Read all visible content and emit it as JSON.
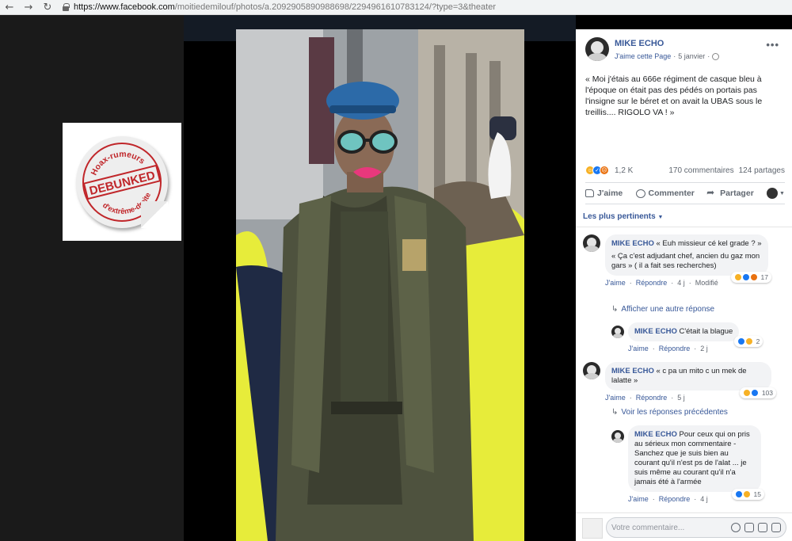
{
  "browser": {
    "url_host": "https://www.facebook.com",
    "url_path": "/moitiedemilouf/photos/a.2092905890988698/2294961610783124/?type=3&theater",
    "back_icon": "←",
    "forward_icon": "→",
    "reload_icon": "↻"
  },
  "badge": {
    "top_text": "Hoax-rumeurs",
    "center_text": "DEBUNKED",
    "bottom_text": "d'extrême-droite"
  },
  "post": {
    "author": "MIKE ECHO",
    "like_page": "J'aime cette Page",
    "date": "5 janvier",
    "more": "•••",
    "text": "« Moi j'étais au 666e régiment de casque bleu à l'époque on était pas des pédés on portais pas l'insigne sur le béret et on avait la UBAS sous le treillis.... RIGOLO VA ! »",
    "reactions_count": "1,2 K",
    "comments_count": "170 commentaires",
    "shares_count": "124 partages"
  },
  "actions": {
    "like": "J'aime",
    "comment": "Commenter",
    "share": "Partager"
  },
  "filter": "Les plus pertinents",
  "comments": [
    {
      "author": "MIKE ECHO",
      "text1": "« Euh missieur cé kel grade ? »",
      "text2": "« Ça c'est adjudant chef, ancien du gaz mon gars » ( il a fait ses recherches)",
      "like": "J'aime",
      "reply": "Répondre",
      "time": "4 j",
      "modified": "Modifié",
      "count": "17"
    },
    {
      "author": "MIKE ECHO",
      "text": "« c pa un mito c un mek de lalatte »",
      "like": "J'aime",
      "reply": "Répondre",
      "time": "5 j",
      "count": "103"
    }
  ],
  "reply_links": {
    "another": "Afficher une autre réponse",
    "previous": "Voir les réponses précédentes"
  },
  "replies": [
    {
      "author": "MIKE ECHO",
      "text": "C'était la blague",
      "like": "J'aime",
      "reply": "Répondre",
      "time": "2 j",
      "count": "2"
    },
    {
      "author": "MIKE ECHO",
      "text": "Pour ceux qui on pris au sérieux mon commentaire - Sanchez que je suis bien au courant qu'il n'est ps de l'alat ... je suis même au courant qu'il n'a jamais été à l'armée",
      "like": "J'aime",
      "reply": "Répondre",
      "time": "4 j",
      "count": "15"
    }
  ],
  "composer": {
    "placeholder": "Votre commentaire..."
  },
  "colors": {
    "fb_blue": "#385898",
    "stamp_red": "#c0262a",
    "vest_yellow": "#e7ec3a"
  }
}
